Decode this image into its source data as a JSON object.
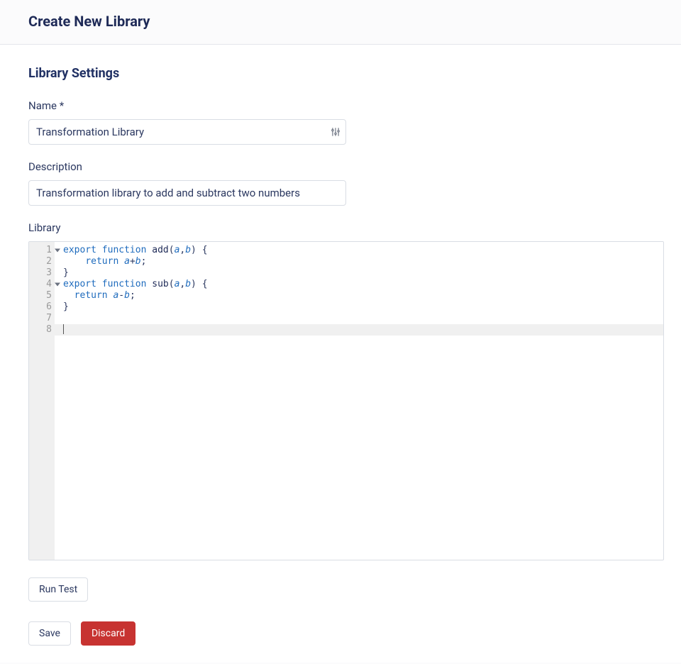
{
  "header": {
    "title": "Create New Library"
  },
  "section": {
    "title": "Library Settings"
  },
  "form": {
    "name_label": "Name *",
    "name_value": "Transformation Library",
    "description_label": "Description",
    "description_value": "Transformation library to add and subtract two numbers",
    "library_label": "Library"
  },
  "code": {
    "gutter": [
      "1",
      "2",
      "3",
      "4",
      "5",
      "6",
      "7",
      "8"
    ],
    "fold_rows": [
      0,
      3
    ],
    "active_row": 7,
    "lines": [
      [
        {
          "t": "export ",
          "c": "tok-kw"
        },
        {
          "t": "function ",
          "c": "tok-kw"
        },
        {
          "t": "add",
          "c": "tok-fn"
        },
        {
          "t": "(",
          "c": "tok-pun"
        },
        {
          "t": "a",
          "c": "tok-arg"
        },
        {
          "t": ",",
          "c": "tok-pun"
        },
        {
          "t": "b",
          "c": "tok-arg"
        },
        {
          "t": ") {",
          "c": "tok-pun"
        }
      ],
      [
        {
          "t": "    ",
          "c": ""
        },
        {
          "t": "return ",
          "c": "tok-kw"
        },
        {
          "t": "a",
          "c": "tok-arg"
        },
        {
          "t": "+",
          "c": "tok-pun"
        },
        {
          "t": "b",
          "c": "tok-arg"
        },
        {
          "t": ";",
          "c": "tok-pun"
        }
      ],
      [
        {
          "t": "}",
          "c": "tok-pun"
        }
      ],
      [
        {
          "t": "export ",
          "c": "tok-kw"
        },
        {
          "t": "function ",
          "c": "tok-kw"
        },
        {
          "t": "sub",
          "c": "tok-fn"
        },
        {
          "t": "(",
          "c": "tok-pun"
        },
        {
          "t": "a",
          "c": "tok-arg"
        },
        {
          "t": ",",
          "c": "tok-pun"
        },
        {
          "t": "b",
          "c": "tok-arg"
        },
        {
          "t": ") {",
          "c": "tok-pun"
        }
      ],
      [
        {
          "t": "  ",
          "c": ""
        },
        {
          "t": "return ",
          "c": "tok-kw"
        },
        {
          "t": "a",
          "c": "tok-arg"
        },
        {
          "t": "-",
          "c": "tok-pun"
        },
        {
          "t": "b",
          "c": "tok-arg"
        },
        {
          "t": ";",
          "c": "tok-pun"
        }
      ],
      [
        {
          "t": "}",
          "c": "tok-pun"
        }
      ],
      [],
      []
    ]
  },
  "buttons": {
    "run_test": "Run Test",
    "save": "Save",
    "discard": "Discard"
  }
}
